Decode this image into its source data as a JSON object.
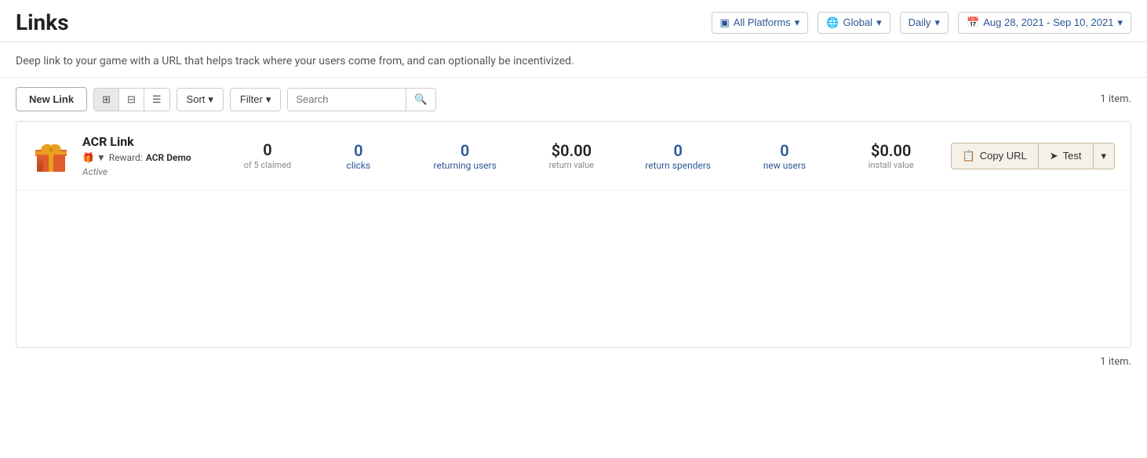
{
  "header": {
    "title": "Links",
    "description": "Deep link to your game with a URL that helps track where your users come from, and can optionally be incentivized."
  },
  "topControls": {
    "platform": "All Platforms",
    "region": "Global",
    "frequency": "Daily",
    "dateRange": "Aug 28, 2021 - Sep 10, 2021"
  },
  "toolbar": {
    "newLinkLabel": "New Link",
    "sortLabel": "Sort",
    "filterLabel": "Filter",
    "searchPlaceholder": "Search",
    "itemCount": "1 item."
  },
  "link": {
    "name": "ACR Link",
    "rewardLabel": "Reward:",
    "rewardName": "ACR Demo",
    "status": "Active",
    "claimed": "0",
    "claimedSub": "of 5 claimed",
    "clicks": "0",
    "clicksLabel": "clicks",
    "returningUsers": "0",
    "returningUsersLabel": "returning users",
    "returnValue": "$0.00",
    "returnValueLabel": "return value",
    "returnSpenders": "0",
    "returnSpendersLabel": "return spenders",
    "newUsers": "0",
    "newUsersLabel": "new users",
    "installValue": "$0.00",
    "installValueLabel": "install value",
    "copyUrlLabel": "Copy URL",
    "testLabel": "Test"
  },
  "bottomCount": "1 item."
}
